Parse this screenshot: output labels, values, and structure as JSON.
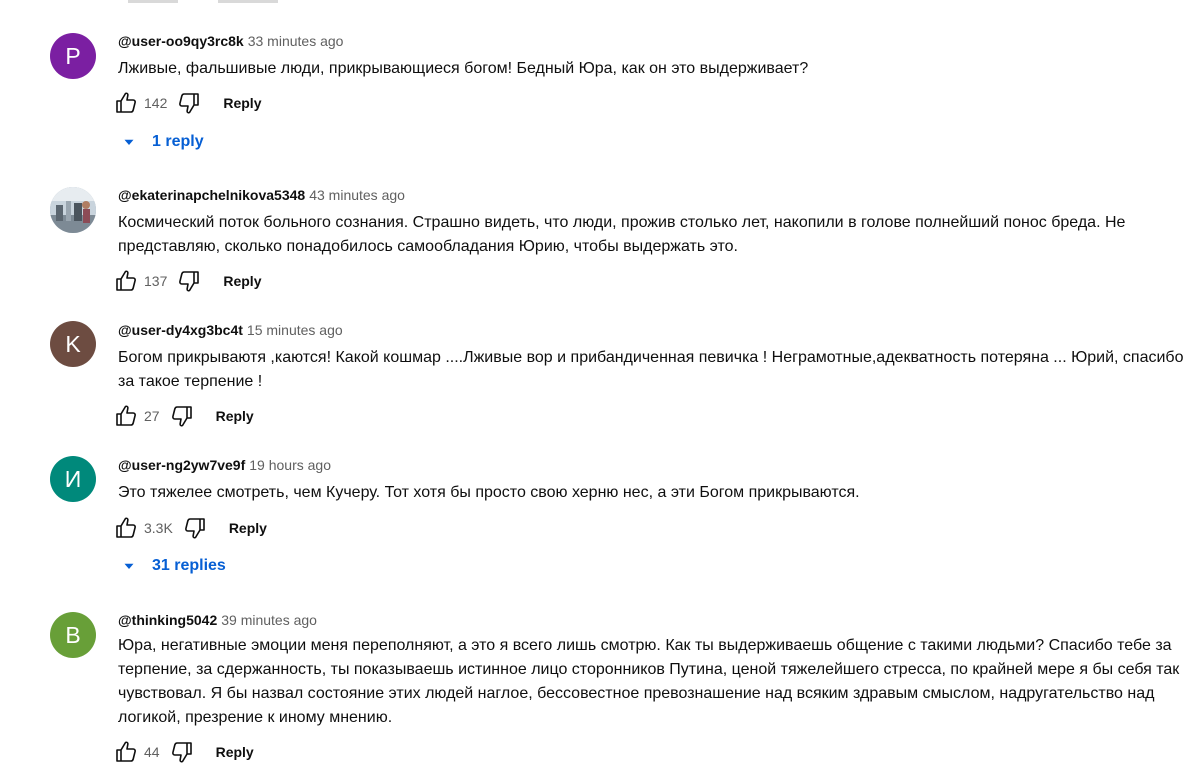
{
  "comments": [
    {
      "avatar_letter": "P",
      "avatar_color": "#7b1fa2",
      "author": "@user-oo9qy3rc8k",
      "time": "33 minutes ago",
      "text": "Лживые, фальшивые люди, прикрывающиеся богом! Бедный Юра, как он это выдерживает?",
      "likes": "142",
      "reply_label": "Reply",
      "replies": "1 reply"
    },
    {
      "avatar_letter": "",
      "avatar_color": "#8a9aa8",
      "author": "@ekaterinapchelnikova5348",
      "time": "43 minutes ago",
      "text": "Космический поток больного сознания. Страшно видеть, что люди, прожив столько лет, накопили в голове полнейший понос бреда. Не представляю, сколько понадобилось самообладания Юрию, чтобы выдержать это.",
      "likes": "137",
      "reply_label": "Reply"
    },
    {
      "avatar_letter": "K",
      "avatar_color": "#6d4c41",
      "author": "@user-dy4xg3bc4t",
      "time": "15 minutes ago",
      "text": "Богом прикрываютя ,каются! Какой кошмар ....Лживые вор и прибандиченная певичка ! Неграмотные,адекватность потеряна ... Юрий, спасибо за такое терпение !",
      "likes": "27",
      "reply_label": "Reply"
    },
    {
      "avatar_letter": "И",
      "avatar_color": "#00897b",
      "author": "@user-ng2yw7ve9f",
      "time": "19 hours ago",
      "text": "Это тяжелее смотреть, чем Кучеру. Тот хотя бы просто свою херню нес, а эти Богом прикрываются.",
      "likes": "3.3K",
      "reply_label": "Reply",
      "replies": "31 replies"
    },
    {
      "avatar_letter": "B",
      "avatar_color": "#689f38",
      "author": "@thinking5042",
      "time": "39 minutes ago",
      "text": "Юра, негативные эмоции меня переполняют, а это я всего лишь смотрю. Как ты выдерживаешь общение с такими людьми? Спасибо тебе за терпение, за сдержанность, ты показываешь истинное лицо сторонников Путина, ценой тяжелейшего стресса, по крайней мере я бы себя так чувствовал. Я бы назвал состояние этих людей наглое, бессовестное превознашение над всяким здравым смыслом, надругательство над логикой, презрение к иному мнению.",
      "likes": "44",
      "reply_label": "Reply"
    }
  ],
  "icons": {
    "like": "thumbs-up-icon",
    "dislike": "thumbs-down-icon",
    "expand": "caret-down-icon"
  }
}
